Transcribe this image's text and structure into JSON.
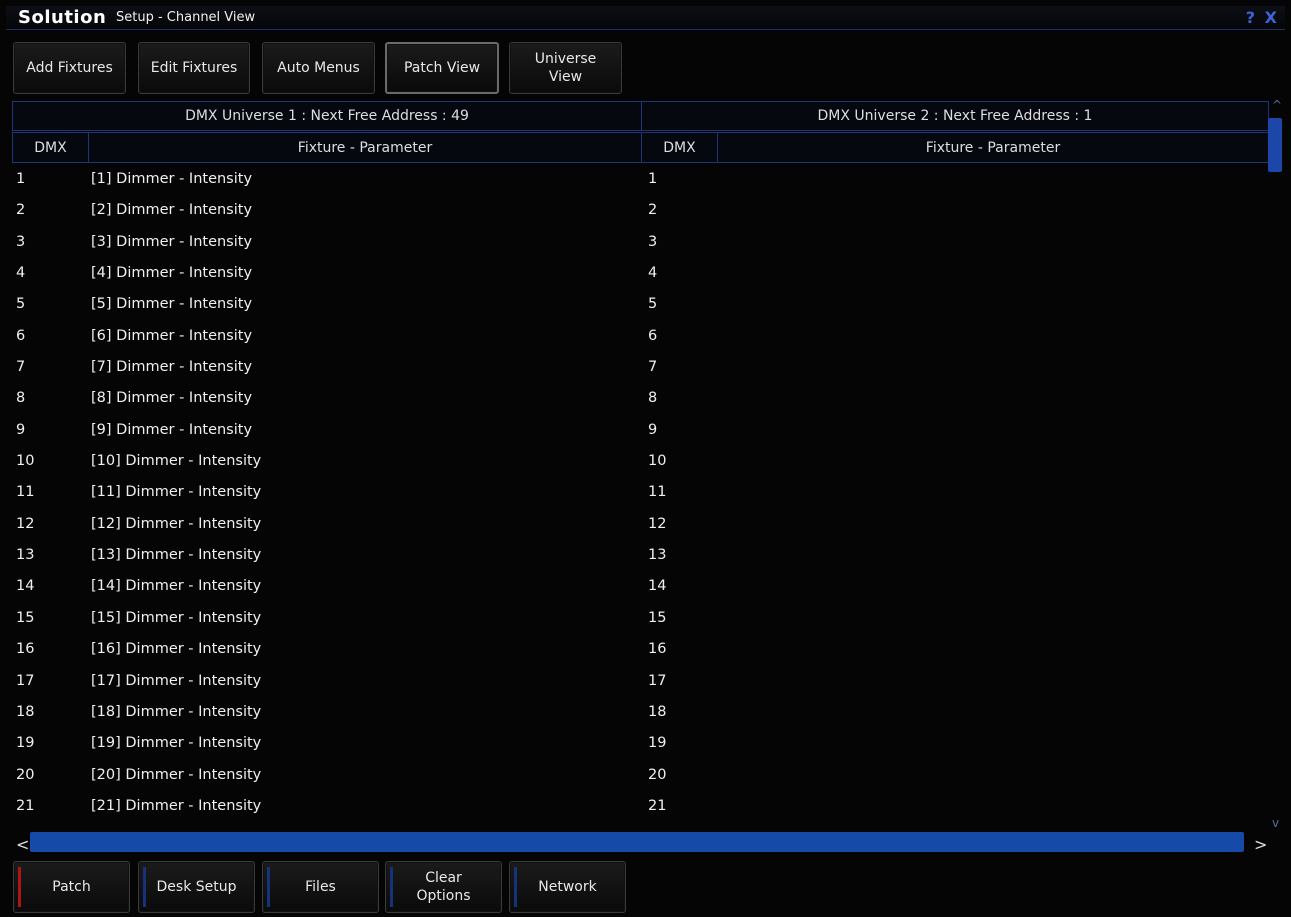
{
  "window": {
    "brand": "Solution",
    "title": "Setup - Channel View",
    "help_icon": "?",
    "close_icon": "X"
  },
  "toolbar": {
    "add_fixtures": "Add Fixtures",
    "edit_fixtures": "Edit Fixtures",
    "auto_menus": "Auto Menus",
    "patch_view": "Patch View",
    "universe_view_line1": "Universe",
    "universe_view_line2": "View"
  },
  "universe1": {
    "header": "DMX Universe 1 : Next Free Address : 49",
    "col_dmx": "DMX",
    "col_fixture": "Fixture - Parameter"
  },
  "universe2": {
    "header": "DMX Universe 2 : Next Free Address : 1",
    "col_dmx": "DMX",
    "col_fixture": "Fixture - Parameter"
  },
  "rows": [
    {
      "dmx1": "1",
      "fixture": "[1] Dimmer - Intensity",
      "dmx2": "1"
    },
    {
      "dmx1": "2",
      "fixture": "[2] Dimmer - Intensity",
      "dmx2": "2"
    },
    {
      "dmx1": "3",
      "fixture": "[3] Dimmer - Intensity",
      "dmx2": "3"
    },
    {
      "dmx1": "4",
      "fixture": "[4] Dimmer - Intensity",
      "dmx2": "4"
    },
    {
      "dmx1": "5",
      "fixture": "[5] Dimmer - Intensity",
      "dmx2": "5"
    },
    {
      "dmx1": "6",
      "fixture": "[6] Dimmer - Intensity",
      "dmx2": "6"
    },
    {
      "dmx1": "7",
      "fixture": "[7] Dimmer - Intensity",
      "dmx2": "7"
    },
    {
      "dmx1": "8",
      "fixture": "[8] Dimmer - Intensity",
      "dmx2": "8"
    },
    {
      "dmx1": "9",
      "fixture": "[9] Dimmer - Intensity",
      "dmx2": "9"
    },
    {
      "dmx1": "10",
      "fixture": "[10] Dimmer - Intensity",
      "dmx2": "10"
    },
    {
      "dmx1": "11",
      "fixture": "[11] Dimmer - Intensity",
      "dmx2": "11"
    },
    {
      "dmx1": "12",
      "fixture": "[12] Dimmer - Intensity",
      "dmx2": "12"
    },
    {
      "dmx1": "13",
      "fixture": "[13] Dimmer - Intensity",
      "dmx2": "13"
    },
    {
      "dmx1": "14",
      "fixture": "[14] Dimmer - Intensity",
      "dmx2": "14"
    },
    {
      "dmx1": "15",
      "fixture": "[15] Dimmer - Intensity",
      "dmx2": "15"
    },
    {
      "dmx1": "16",
      "fixture": "[16] Dimmer - Intensity",
      "dmx2": "16"
    },
    {
      "dmx1": "17",
      "fixture": "[17] Dimmer - Intensity",
      "dmx2": "17"
    },
    {
      "dmx1": "18",
      "fixture": "[18] Dimmer - Intensity",
      "dmx2": "18"
    },
    {
      "dmx1": "19",
      "fixture": "[19] Dimmer - Intensity",
      "dmx2": "19"
    },
    {
      "dmx1": "20",
      "fixture": "[20] Dimmer - Intensity",
      "dmx2": "20"
    },
    {
      "dmx1": "21",
      "fixture": "[21] Dimmer - Intensity",
      "dmx2": "21"
    }
  ],
  "scroll": {
    "up_arrow": "^",
    "down_arrow": "v",
    "left_arrow": "<",
    "right_arrow": ">"
  },
  "bottom_bar": {
    "patch": "Patch",
    "desk_setup": "Desk Setup",
    "files": "Files",
    "clear_options_line1": "Clear",
    "clear_options_line2": "Options",
    "network": "Network"
  },
  "colors": {
    "accent_blue": "#164aa8",
    "border_blue": "#1f3576",
    "active_red": "#b01515"
  }
}
